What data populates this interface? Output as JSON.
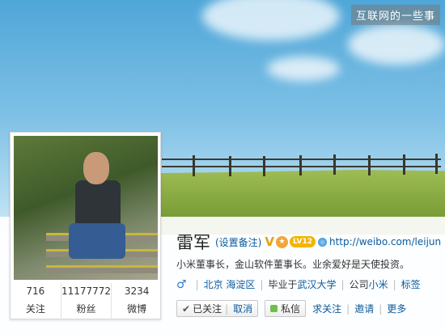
{
  "watermark": "互联网的一些事",
  "profile": {
    "name": "雷军",
    "remark_link": "(设置备注)",
    "verified_badge": "V",
    "level_badge": "LV12",
    "url": "http://weibo.com/leijun",
    "bio": "小米董事长，金山软件董事长。业余爱好是天使投资。",
    "gender_symbol": "♂",
    "location": "北京 海淀区",
    "education_prefix": "毕业于",
    "education": "武汉大学",
    "company_prefix": "公司",
    "company": "小米",
    "tags_label": "标签"
  },
  "stats": [
    {
      "value": "716",
      "label": "关注"
    },
    {
      "value": "11177772",
      "label": "粉丝"
    },
    {
      "value": "3234",
      "label": "微博"
    }
  ],
  "actions": {
    "following_label": "已关注",
    "cancel_label": "取消",
    "message_label": "私信",
    "more_1": "求关注",
    "more_2": "邀请",
    "more_3": "更多"
  },
  "colors": {
    "link": "#0a5a9c",
    "level_badge": "#f4b400",
    "verified": "#e9a100"
  }
}
